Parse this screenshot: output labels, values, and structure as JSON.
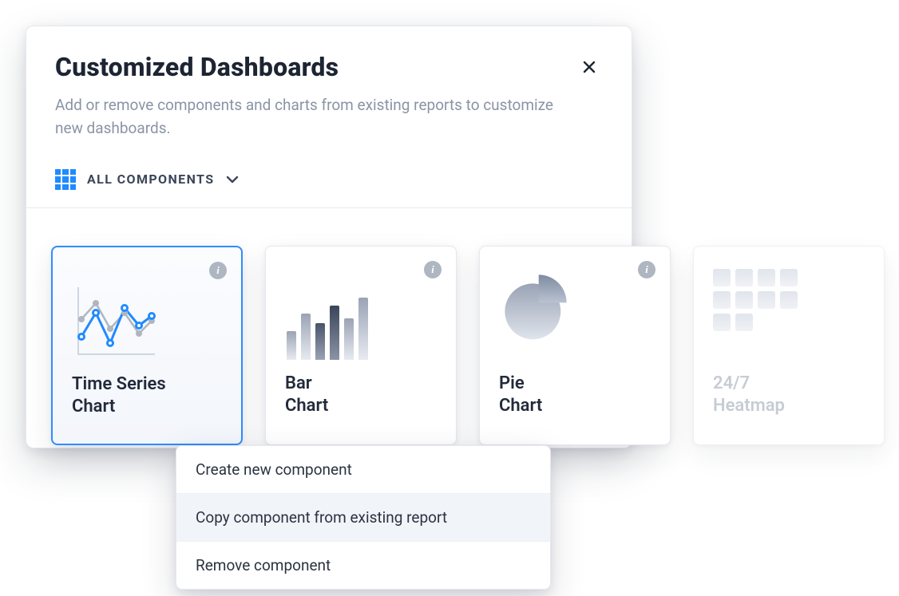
{
  "panel": {
    "title": "Customized Dashboards",
    "subtitle": "Add or remove components and charts from existing reports to customize new dashboards.",
    "filter_label": "ALL COMPONENTS"
  },
  "cards": [
    {
      "title_line1": "Time Series",
      "title_line2": "Chart",
      "selected": true,
      "faded": false
    },
    {
      "title_line1": "Bar",
      "title_line2": "Chart",
      "selected": false,
      "faded": false
    },
    {
      "title_line1": "Pie",
      "title_line2": "Chart",
      "selected": false,
      "faded": false
    },
    {
      "title_line1": "24/7",
      "title_line2": "Heatmap",
      "selected": false,
      "faded": true
    }
  ],
  "menu": {
    "items": [
      {
        "label": "Create new component",
        "hover": false
      },
      {
        "label": "Copy component from existing report",
        "hover": true
      },
      {
        "label": "Remove component",
        "hover": false
      }
    ]
  },
  "icons": {
    "info_glyph": "i"
  }
}
